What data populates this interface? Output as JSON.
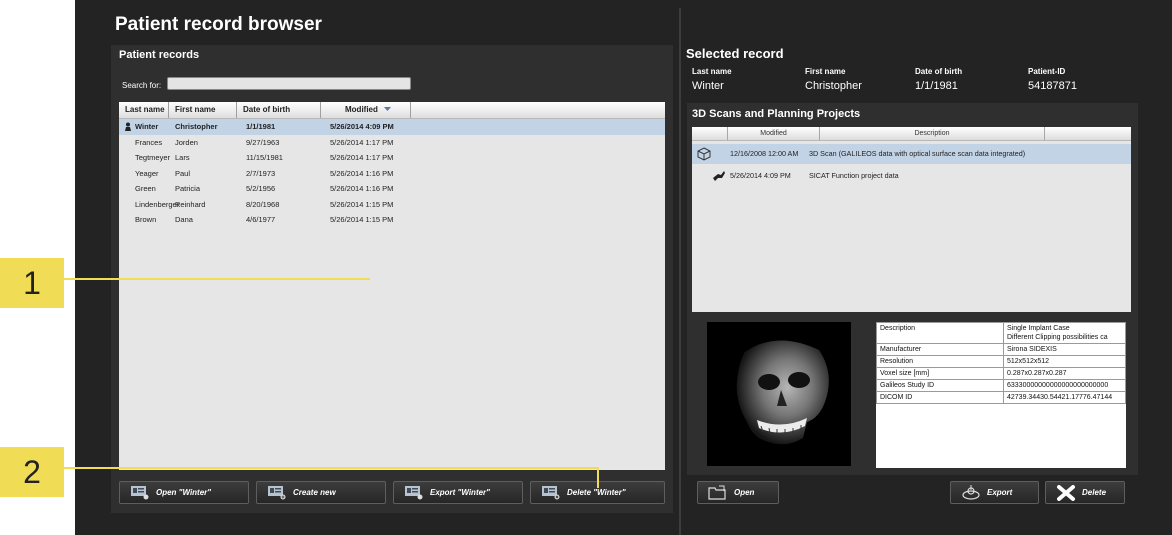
{
  "app_title": "Patient record browser",
  "patient_records": {
    "title": "Patient records",
    "search_label": "Search for:",
    "search_value": "",
    "columns": [
      "Last name",
      "First name",
      "Date of birth",
      "Modified"
    ],
    "sort_indicator": "chevron-down-icon",
    "rows": [
      {
        "last": "Winter",
        "first": "Christopher",
        "dob": "1/1/1981",
        "modified": "5/26/2014 4:09 PM",
        "selected": true
      },
      {
        "last": "Frances",
        "first": "Jorden",
        "dob": "9/27/1963",
        "modified": "5/26/2014 1:17 PM"
      },
      {
        "last": "Tegtmeyer",
        "first": "Lars",
        "dob": "11/15/1981",
        "modified": "5/26/2014 1:17 PM"
      },
      {
        "last": "Yeager",
        "first": "Paul",
        "dob": "2/7/1973",
        "modified": "5/26/2014 1:16 PM"
      },
      {
        "last": "Green",
        "first": "Patricia",
        "dob": "5/2/1956",
        "modified": "5/26/2014 1:16 PM"
      },
      {
        "last": "Lindenberger",
        "first": "Reinhard",
        "dob": "8/20/1968",
        "modified": "5/26/2014 1:15 PM"
      },
      {
        "last": "Brown",
        "first": "Dana",
        "dob": "4/6/1977",
        "modified": "5/26/2014 1:15 PM"
      }
    ],
    "buttons": {
      "open": "Open \"Winter\"",
      "create": "Create new",
      "export": "Export \"Winter\"",
      "delete": "Delete \"Winter\""
    }
  },
  "selected_record": {
    "title": "Selected record",
    "headers": [
      "Last name",
      "First name",
      "Date of birth",
      "Patient-ID"
    ],
    "values": [
      "Winter",
      "Christopher",
      "1/1/1981",
      "54187871"
    ]
  },
  "scans": {
    "title": "3D Scans and Planning Projects",
    "columns": [
      "Modified",
      "Description"
    ],
    "rows": [
      {
        "icon": "cube-icon",
        "modified": "12/16/2008 12:00 AM",
        "description": "3D Scan (GALILEOS data with optical surface scan data integrated)",
        "selected": true
      },
      {
        "icon": "sicat-function-icon",
        "modified": "5/26/2014 4:09 PM",
        "description": "SICAT Function project data"
      }
    ],
    "properties": [
      {
        "key": "Description",
        "value": "Single Implant Case",
        "value2": "Different Clipping possibilities ca"
      },
      {
        "key": "Manufacturer",
        "value": "Sirona SIDEXIS"
      },
      {
        "key": "Resolution",
        "value": "512x512x512"
      },
      {
        "key": "Voxel size [mm]",
        "value": "0.287x0.287x0.287"
      },
      {
        "key": "Galileos Study ID",
        "value": "63330000000000000000000000"
      },
      {
        "key": "DICOM ID",
        "value": "42739.34430.54421.17776.47144"
      }
    ],
    "buttons": {
      "open": "Open",
      "export": "Export",
      "delete": "Delete"
    }
  },
  "callouts": [
    "1",
    "2"
  ],
  "colors": {
    "background": "#232323",
    "panel": "#2f2f2f",
    "selection": "#c3d3e6",
    "callout": "#f0dc55"
  }
}
